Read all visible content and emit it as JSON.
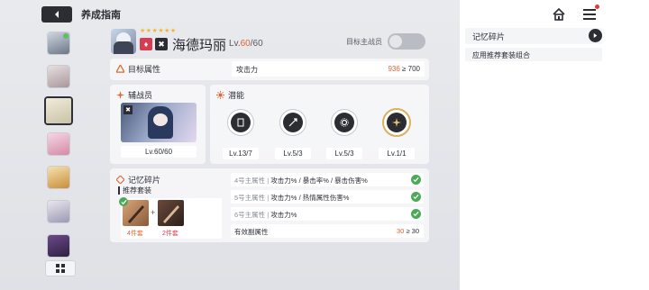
{
  "header": {
    "title": "养成指南"
  },
  "character": {
    "name": "海德玛丽",
    "level_prefix": "Lv.",
    "level_current": "60",
    "level_max": "/60",
    "stars": "★★★★★★",
    "main_member_label": "目标主战员",
    "main_member_toggle": false
  },
  "target_attr": {
    "section_label": "目标属性",
    "row_label": "攻击力",
    "current": "936",
    "compare": "≥ 700"
  },
  "assist": {
    "section_label": "辅战员",
    "level": "Lv.60/60"
  },
  "potential": {
    "section_label": "潜能",
    "items": [
      {
        "level": "Lv.13/7"
      },
      {
        "level": "Lv.5/3"
      },
      {
        "level": "Lv.5/3"
      },
      {
        "level": "Lv.1/1"
      }
    ]
  },
  "memory": {
    "section_label": "记忆碎片",
    "recommended_label": "推荐套装",
    "set_a_count": "4件套",
    "set_b_count": "2件套",
    "plus": "+",
    "rows": [
      {
        "slot": "4号主属性",
        "sep": "|",
        "value": "攻击力% / 暴击率% / 暴击伤害%"
      },
      {
        "slot": "5号主属性",
        "sep": "|",
        "value": "攻击力% / 热情属性伤害%"
      },
      {
        "slot": "6号主属性",
        "sep": "|",
        "value": "攻击力%"
      }
    ],
    "effective_label": "有效副属性",
    "effective_current": "30",
    "effective_compare": "≥ 30"
  },
  "right_panel": {
    "title": "记忆碎片",
    "subtitle": "应用推荐套装组合"
  },
  "colors": {
    "accent_orange": "#e0662f",
    "check_green": "#4ea85a",
    "star_gold": "#f2b632",
    "dark": "#2b2d33"
  }
}
